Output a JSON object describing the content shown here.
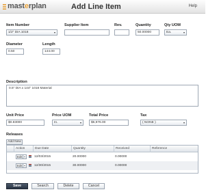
{
  "header": {
    "logo_pre": "mast",
    "logo_accent": "e",
    "logo_post": "rplan",
    "title": "Add Line Item",
    "help": "Help"
  },
  "form": {
    "item_number": {
      "label": "Item Number",
      "value": "1/2\" DIA 1018"
    },
    "supplier_item": {
      "label": "Supplier Item",
      "value": ""
    },
    "revision": {
      "label": "Rev.",
      "value": ""
    },
    "quantity": {
      "label": "Quantity",
      "value": "50.00000"
    },
    "qty_uom": {
      "label": "Qty UOM",
      "value": "Ea."
    },
    "diameter": {
      "label": "Diameter",
      "value": "0.50"
    },
    "length": {
      "label": "Length",
      "value": "144.00"
    },
    "description": {
      "label": "Description",
      "value": "0.5\" DIA x 144\" 1018 Material"
    },
    "unit_price": {
      "label": "Unit Price",
      "value": "$0.83000"
    },
    "price_uom": {
      "label": "Price UOM",
      "value": "In."
    },
    "total_price": {
      "label": "Total Price",
      "value": "$5,976.00"
    },
    "tax": {
      "label": "Tax",
      "value": "( NONE )"
    }
  },
  "releases": {
    "label": "Releases",
    "add_new": "Add New",
    "columns": [
      "Action",
      "Due Date",
      "Quantity",
      "Received",
      "Reference"
    ],
    "rows": [
      {
        "edit": "Edit",
        "due_date": "12/03/2015",
        "quantity": "20.00000",
        "received": "0.00000",
        "reference": ""
      },
      {
        "edit": "Edit",
        "due_date": "12/30/2015",
        "quantity": "30.00000",
        "received": "0.00000",
        "reference": ""
      }
    ]
  },
  "buttons": {
    "save": "Save",
    "search": "Search",
    "delete": "Delete",
    "cancel": "Cancel"
  },
  "colors": {
    "logo_accent": "#e8a23b",
    "primary_button": "#2f3a4a"
  }
}
